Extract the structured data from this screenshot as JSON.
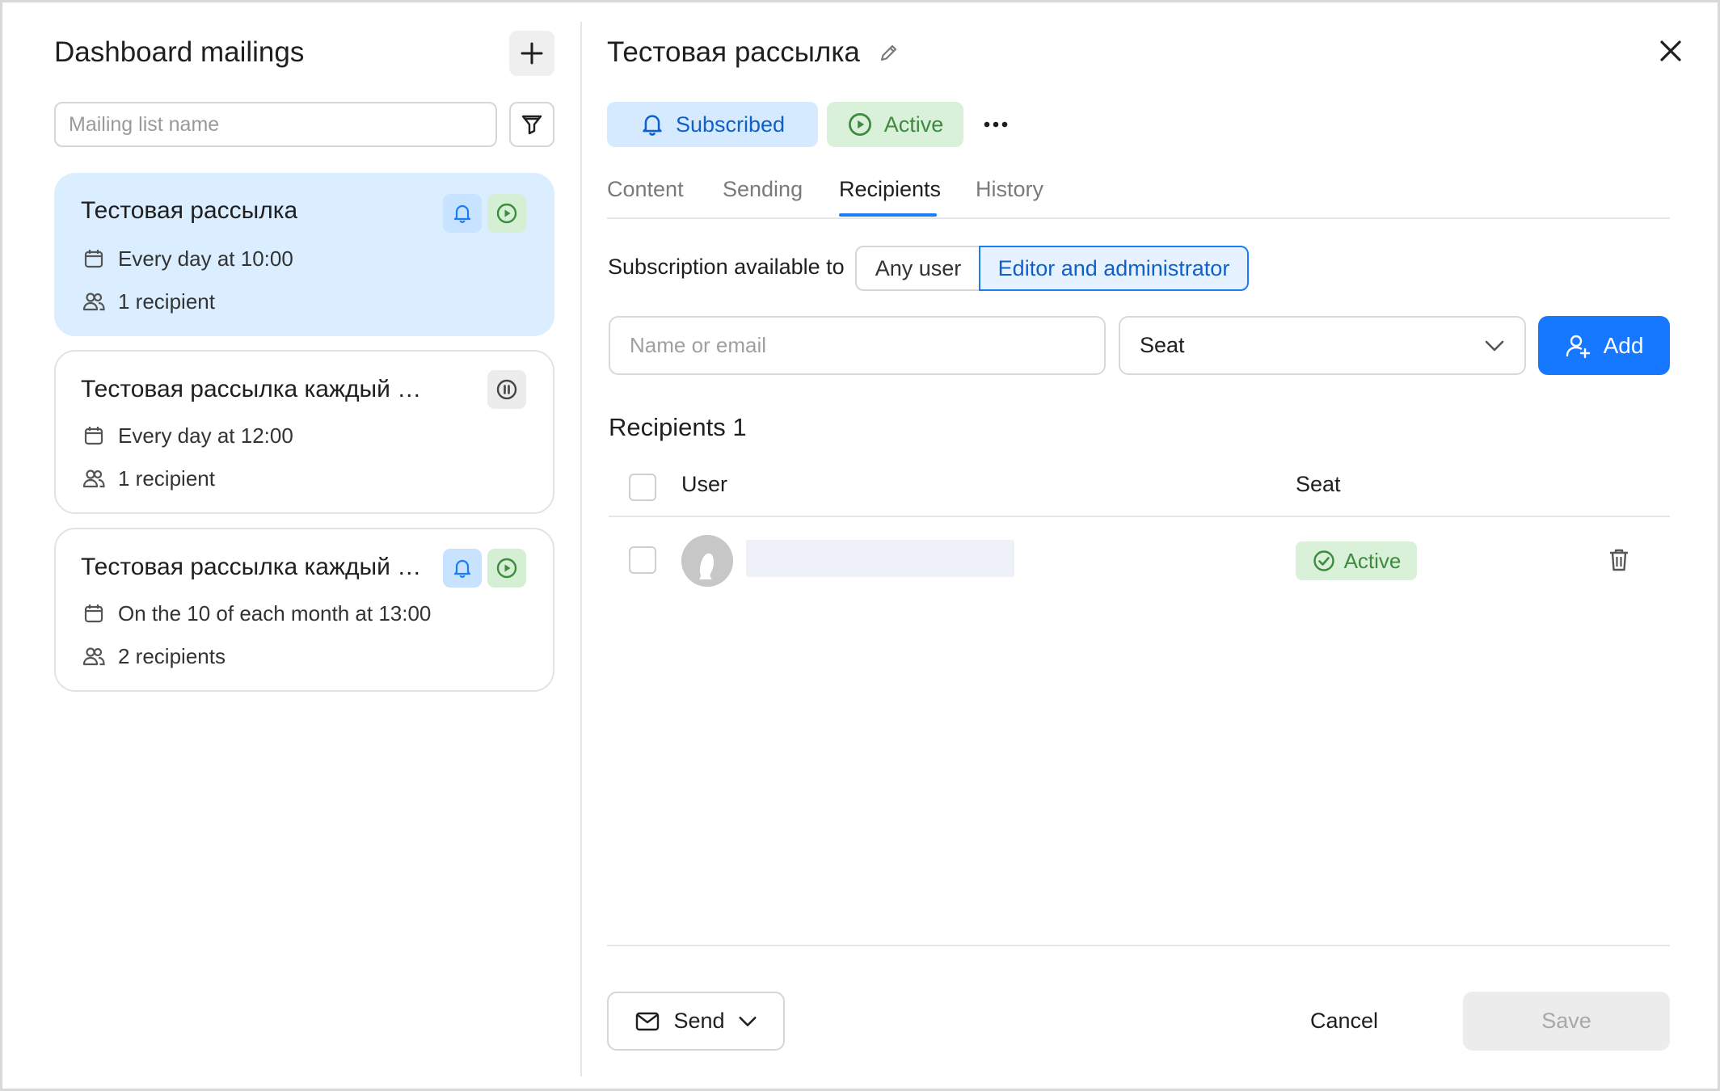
{
  "left": {
    "title": "Dashboard mailings",
    "search_placeholder": "Mailing list name",
    "mailings": [
      {
        "title": "Тестовая рассылка",
        "schedule": "Every day at 10:00",
        "recipients": "1 recipient",
        "subscribed": true,
        "status": "active"
      },
      {
        "title": "Тестовая рассылка каждый день",
        "schedule": "Every day at 12:00",
        "recipients": "1 recipient",
        "subscribed": false,
        "status": "paused"
      },
      {
        "title": "Тестовая рассылка каждый м...",
        "schedule": "On the 10 of each month at 13:00",
        "recipients": "2 recipients",
        "subscribed": true,
        "status": "active"
      }
    ]
  },
  "detail": {
    "title": "Тестовая рассылка",
    "subscribed_label": "Subscribed",
    "active_label": "Active",
    "tabs": [
      "Content",
      "Sending",
      "Recipients",
      "History"
    ],
    "active_tab": "Recipients",
    "subscription_label": "Subscription available to",
    "subscription_options": [
      "Any user",
      "Editor and administrator"
    ],
    "subscription_selected": "Editor and administrator",
    "name_placeholder": "Name or email",
    "seat_select_value": "Seat",
    "add_label": "Add",
    "recipients_title": "Recipients 1",
    "table": {
      "columns": [
        "User",
        "Seat"
      ],
      "rows": [
        {
          "user": "",
          "seat": "Active"
        }
      ]
    },
    "send_label": "Send",
    "cancel_label": "Cancel",
    "save_label": "Save"
  },
  "colors": {
    "accent": "#1677ff",
    "selected_card": "#dbeeff",
    "active_green": "#3e8a3e",
    "active_bg": "#d9f0d9"
  }
}
